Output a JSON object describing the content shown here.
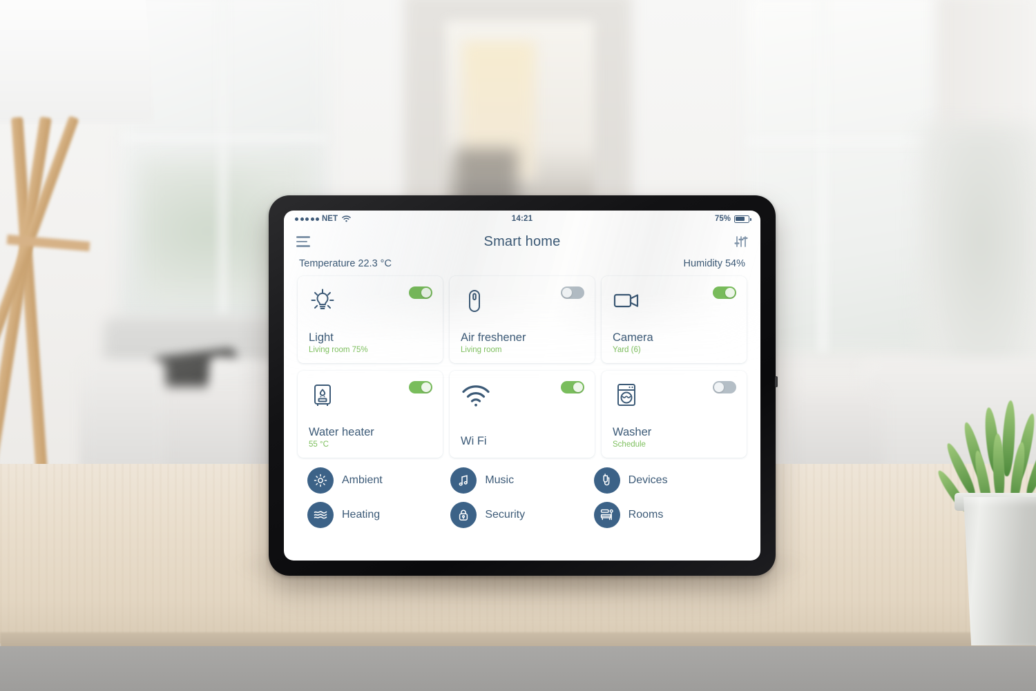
{
  "status_bar": {
    "carrier": "NET",
    "signal_dots": 5,
    "wifi_icon": "wifi-icon",
    "time": "14:21",
    "battery_percent": "75%",
    "battery_level": 75,
    "battery_icon": "battery-icon"
  },
  "app_bar": {
    "menu_icon": "hamburger-menu-icon",
    "title": "Smart home",
    "settings_icon": "sliders-icon"
  },
  "sensors": {
    "temperature": "Temperature 22.3 °C",
    "humidity": "Humidity 54%"
  },
  "cards": [
    {
      "icon": "lightbulb-icon",
      "title": "Light",
      "subtitle": "Living room 75%",
      "toggle": "on"
    },
    {
      "icon": "air-freshener-icon",
      "title": "Air freshener",
      "subtitle": "Living room",
      "toggle": "off"
    },
    {
      "icon": "video-camera-icon",
      "title": "Camera",
      "subtitle": "Yard (6)",
      "toggle": "on"
    },
    {
      "icon": "water-heater-icon",
      "title": "Water heater",
      "subtitle": "55 °C",
      "toggle": "on"
    },
    {
      "icon": "wifi-icon",
      "title": "Wi Fi",
      "subtitle": "",
      "toggle": "on"
    },
    {
      "icon": "washing-machine-icon",
      "title": "Washer",
      "subtitle": "Schedule",
      "toggle": "off"
    }
  ],
  "menu": [
    {
      "icon": "sun-icon",
      "label": "Ambient"
    },
    {
      "icon": "music-note-icon",
      "label": "Music"
    },
    {
      "icon": "plug-icon",
      "label": "Devices"
    },
    {
      "icon": "waves-icon",
      "label": "Heating"
    },
    {
      "icon": "lock-icon",
      "label": "Security"
    },
    {
      "icon": "furniture-icon",
      "label": "Rooms"
    }
  ],
  "colors": {
    "accent_blue": "#3c5a77",
    "toggle_on_green": "#79bd5c",
    "toggle_off_gray": "#b4bec6",
    "subtitle_green": "#7dbf5d",
    "menu_circle_blue": "#3c6287",
    "card_background": "#ffffff",
    "screen_background": "#ffffff"
  }
}
